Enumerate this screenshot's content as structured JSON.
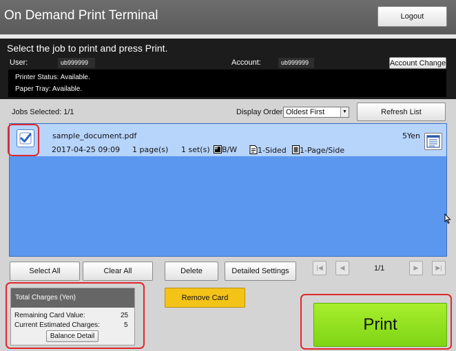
{
  "app": {
    "title": "On Demand Print Terminal",
    "logout": "Logout"
  },
  "info": {
    "instruction": "Select the job to print and press Print.",
    "user_label": "User:",
    "user_value": "ub999999",
    "account_label": "Account:",
    "account_value": "ub999999",
    "account_change": "Account Change",
    "printer_status": "Printer Status: Available.",
    "paper_tray": "Paper Tray: Available."
  },
  "toolbar": {
    "jobs_selected": "Jobs Selected: 1/1",
    "display_order_label": "Display Order:",
    "display_order_value": "Oldest First",
    "refresh": "Refresh List"
  },
  "jobs": [
    {
      "name": "sample_document.pdf",
      "datetime": "2017-04-25 09:09",
      "pages": "1 page(s)",
      "sets": "1 set(s)",
      "color": "B/W",
      "sided": "1-Sided",
      "layout": "1-Page/Side",
      "price": "5Yen",
      "selected": true
    }
  ],
  "actions": {
    "select_all": "Select All",
    "clear_all": "Clear All",
    "delete": "Delete",
    "detailed_settings": "Detailed Settings",
    "page_count": "1/1"
  },
  "charges": {
    "header": "Total Charges (Yen)",
    "remaining_label": "Remaining Card Value:",
    "remaining_value": "25",
    "estimated_label": "Current Estimated Charges:",
    "estimated_value": "5",
    "balance_detail": "Balance Detail"
  },
  "remove_card": "Remove Card",
  "print": "Print",
  "colors": {
    "highlight": "#e0262b",
    "print_green": "#8fdf1c",
    "remove_yellow": "#f4c318",
    "list_blue": "#5b97ef",
    "row_blue": "#b7d4fb"
  },
  "icons": [
    "checkmark-icon",
    "color-mode-icon",
    "duplex-icon",
    "page-layout-icon",
    "job-detail-icon",
    "first-page-icon",
    "prev-page-icon",
    "next-page-icon",
    "last-page-icon",
    "mouse-cursor-icon"
  ]
}
